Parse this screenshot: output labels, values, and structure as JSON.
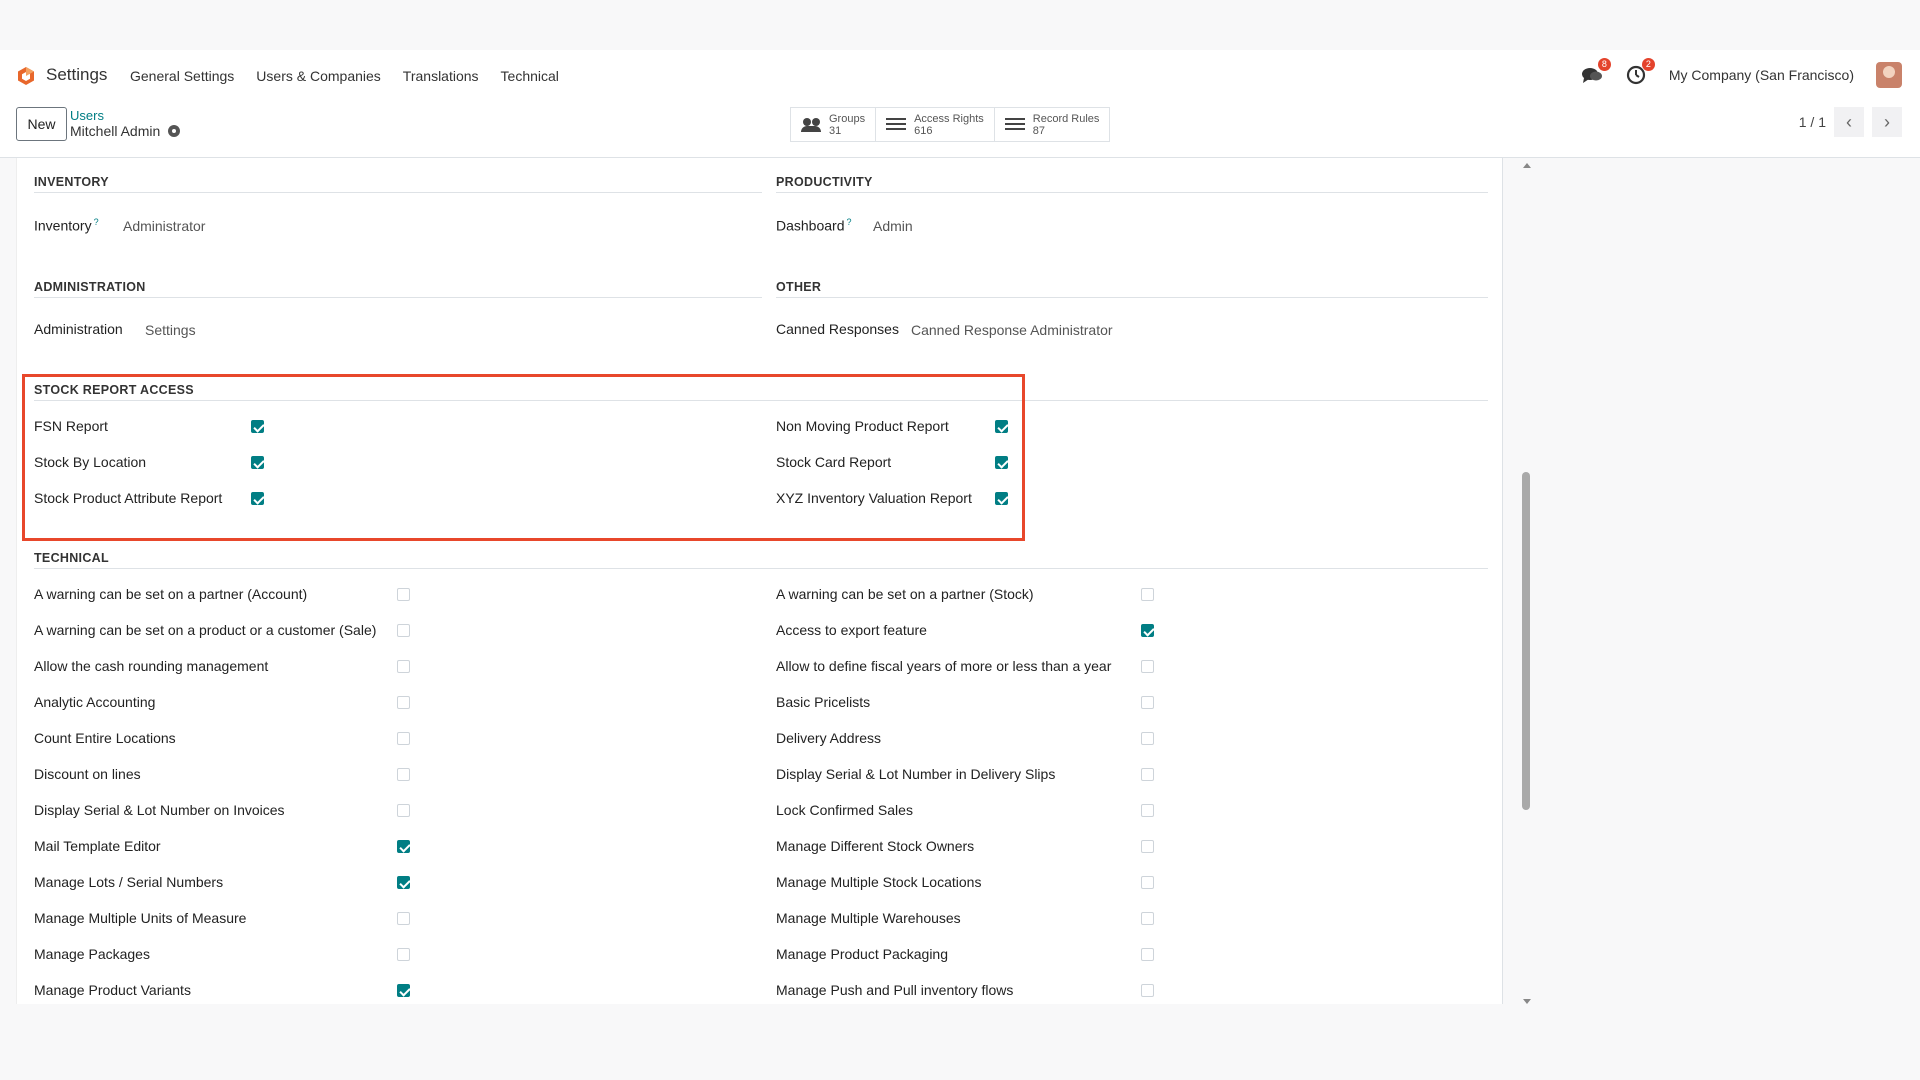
{
  "navbar": {
    "app_title": "Settings",
    "menu": [
      "General Settings",
      "Users & Companies",
      "Translations",
      "Technical"
    ],
    "chat_badge": "8",
    "activity_badge": "2",
    "company": "My Company (San Francisco)"
  },
  "control_panel": {
    "new_label": "New",
    "breadcrumb": "Users",
    "record_name": "Mitchell Admin",
    "smart_buttons": [
      {
        "label": "Groups",
        "count": "31"
      },
      {
        "label": "Access Rights",
        "count": "616"
      },
      {
        "label": "Record Rules",
        "count": "87"
      }
    ],
    "pager": "1 / 1"
  },
  "sections": {
    "inventory": {
      "title": "INVENTORY",
      "label": "Inventory",
      "value": "Administrator"
    },
    "productivity": {
      "title": "PRODUCTIVITY",
      "label": "Dashboard",
      "value": "Admin"
    },
    "administration": {
      "title": "ADMINISTRATION",
      "label": "Administration",
      "value": "Settings"
    },
    "other": {
      "title": "OTHER",
      "label": "Canned Responses",
      "value": "Canned Response Administrator"
    },
    "stock_report": {
      "title": "STOCK REPORT ACCESS",
      "left": [
        {
          "label": "FSN Report",
          "checked": true
        },
        {
          "label": "Stock By Location",
          "checked": true
        },
        {
          "label": "Stock Product Attribute Report",
          "checked": true
        }
      ],
      "right": [
        {
          "label": "Non Moving Product Report",
          "checked": true
        },
        {
          "label": "Stock Card Report",
          "checked": true
        },
        {
          "label": "XYZ Inventory Valuation Report",
          "checked": true
        }
      ]
    },
    "technical": {
      "title": "TECHNICAL",
      "left": [
        {
          "label": "A warning can be set on a partner (Account)",
          "checked": false
        },
        {
          "label": "A warning can be set on a product or a customer (Sale)",
          "checked": false
        },
        {
          "label": "Allow the cash rounding management",
          "checked": false
        },
        {
          "label": "Analytic Accounting",
          "checked": false
        },
        {
          "label": "Count Entire Locations",
          "checked": false
        },
        {
          "label": "Discount on lines",
          "checked": false
        },
        {
          "label": "Display Serial & Lot Number on Invoices",
          "checked": false
        },
        {
          "label": "Mail Template Editor",
          "checked": true
        },
        {
          "label": "Manage Lots / Serial Numbers",
          "checked": true
        },
        {
          "label": "Manage Multiple Units of Measure",
          "checked": false
        },
        {
          "label": "Manage Packages",
          "checked": false
        },
        {
          "label": "Manage Product Variants",
          "checked": true
        }
      ],
      "right": [
        {
          "label": "A warning can be set on a partner (Stock)",
          "checked": false
        },
        {
          "label": "Access to export feature",
          "checked": true
        },
        {
          "label": "Allow to define fiscal years of more or less than a year",
          "checked": false
        },
        {
          "label": "Basic Pricelists",
          "checked": false
        },
        {
          "label": "Delivery Address",
          "checked": false
        },
        {
          "label": "Display Serial & Lot Number in Delivery Slips",
          "checked": false
        },
        {
          "label": "Lock Confirmed Sales",
          "checked": false
        },
        {
          "label": "Manage Different Stock Owners",
          "checked": false
        },
        {
          "label": "Manage Multiple Stock Locations",
          "checked": false
        },
        {
          "label": "Manage Multiple Warehouses",
          "checked": false
        },
        {
          "label": "Manage Product Packaging",
          "checked": false
        },
        {
          "label": "Manage Push and Pull inventory flows",
          "checked": false
        }
      ]
    }
  },
  "colors": {
    "accent": "#017e84",
    "highlight": "#e8472b",
    "badge": "#e4432c"
  }
}
